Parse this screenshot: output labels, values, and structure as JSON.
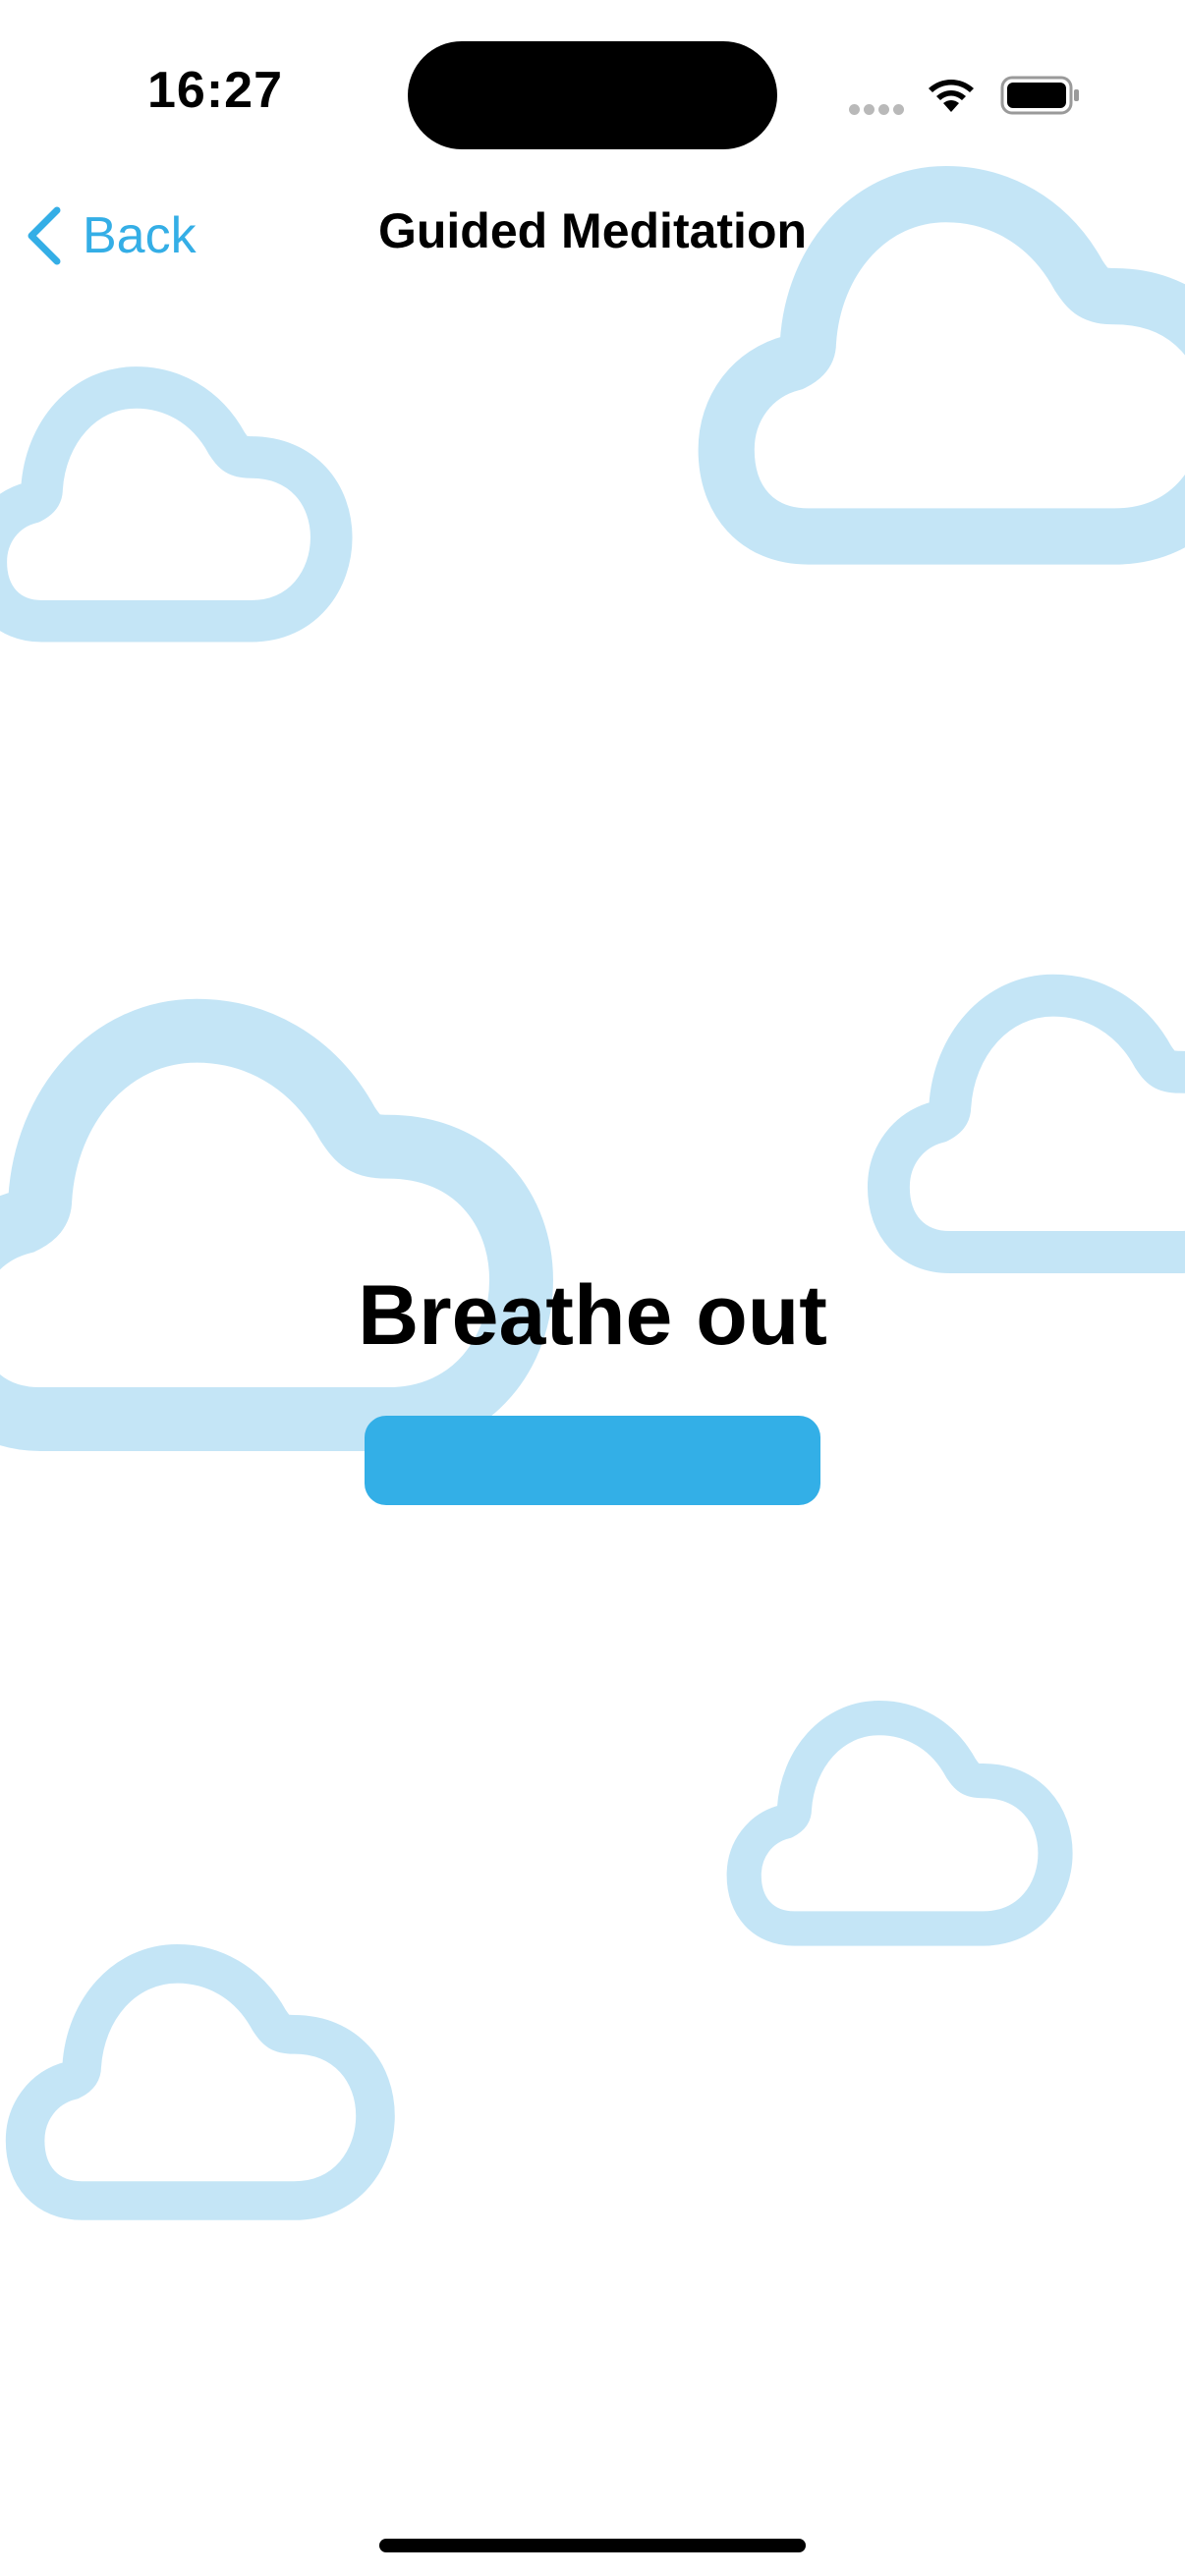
{
  "status_bar": {
    "time": "16:27",
    "icons": [
      "cellular-dots-icon",
      "wifi-icon",
      "battery-icon"
    ]
  },
  "nav": {
    "back_label": "Back",
    "title": "Guided Meditation"
  },
  "content": {
    "instruction": "Breathe out"
  },
  "colors": {
    "accent": "#34aee6",
    "progress": "#33afe7",
    "cloud": "#c4e5f6",
    "text": "#000000",
    "background": "#ffffff"
  }
}
